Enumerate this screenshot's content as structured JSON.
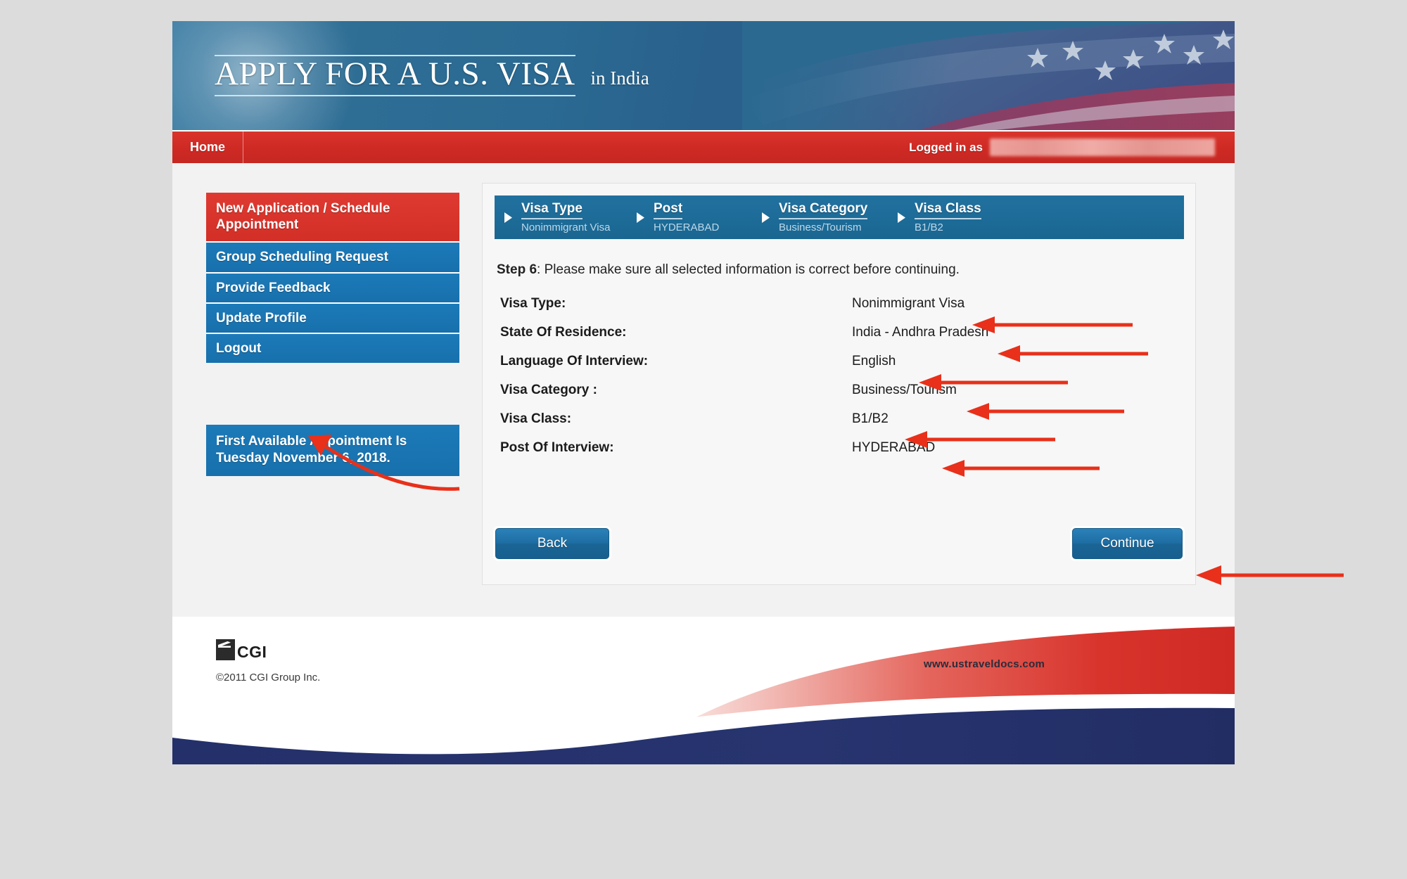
{
  "banner": {
    "title": "APPLY FOR A U.S. VISA",
    "country": "in India"
  },
  "navbar": {
    "home_label": "Home",
    "logged_in_label": "Logged in as",
    "username_redacted": ""
  },
  "sidebar": {
    "items": [
      {
        "label": "New Application / Schedule Appointment",
        "state": "active"
      },
      {
        "label": "Group Scheduling Request",
        "state": "normal"
      },
      {
        "label": "Provide Feedback",
        "state": "normal"
      },
      {
        "label": "Update Profile",
        "state": "normal"
      },
      {
        "label": "Logout",
        "state": "normal"
      }
    ],
    "notice": "First Available Appointment Is Tuesday November 6, 2018."
  },
  "breadcrumb": [
    {
      "title": "Visa Type",
      "value": "Nonimmigrant Visa"
    },
    {
      "title": "Post",
      "value": "HYDERABAD"
    },
    {
      "title": "Visa Category",
      "value": "Business/Tourism"
    },
    {
      "title": "Visa Class",
      "value": "B1/B2"
    }
  ],
  "main": {
    "step_label": "Step 6",
    "step_text": ": Please make sure all selected information is correct before continuing.",
    "rows": [
      {
        "label": "Visa Type:",
        "value": "Nonimmigrant Visa"
      },
      {
        "label": "State Of Residence:",
        "value": "India - Andhra Pradesh"
      },
      {
        "label": "Language Of Interview:",
        "value": "English"
      },
      {
        "label": "Visa Category :",
        "value": "Business/Tourism"
      },
      {
        "label": "Visa Class:",
        "value": "B1/B2"
      },
      {
        "label": "Post Of Interview:",
        "value": "HYDERABAD"
      }
    ],
    "back_label": "Back",
    "continue_label": "Continue"
  },
  "footer": {
    "logo_text": "CGI",
    "copyright": "©2011 CGI Group Inc.",
    "url": "www.ustraveldocs.com"
  },
  "colors": {
    "nav_red": "#cf2a24",
    "menu_blue": "#1c7ab8",
    "crumb_blue": "#1a6691",
    "annotation_red": "#e8301a",
    "footer_navy": "#25316b",
    "page_background": "#f2f2f2",
    "outer_background": "#dcdcdc"
  }
}
